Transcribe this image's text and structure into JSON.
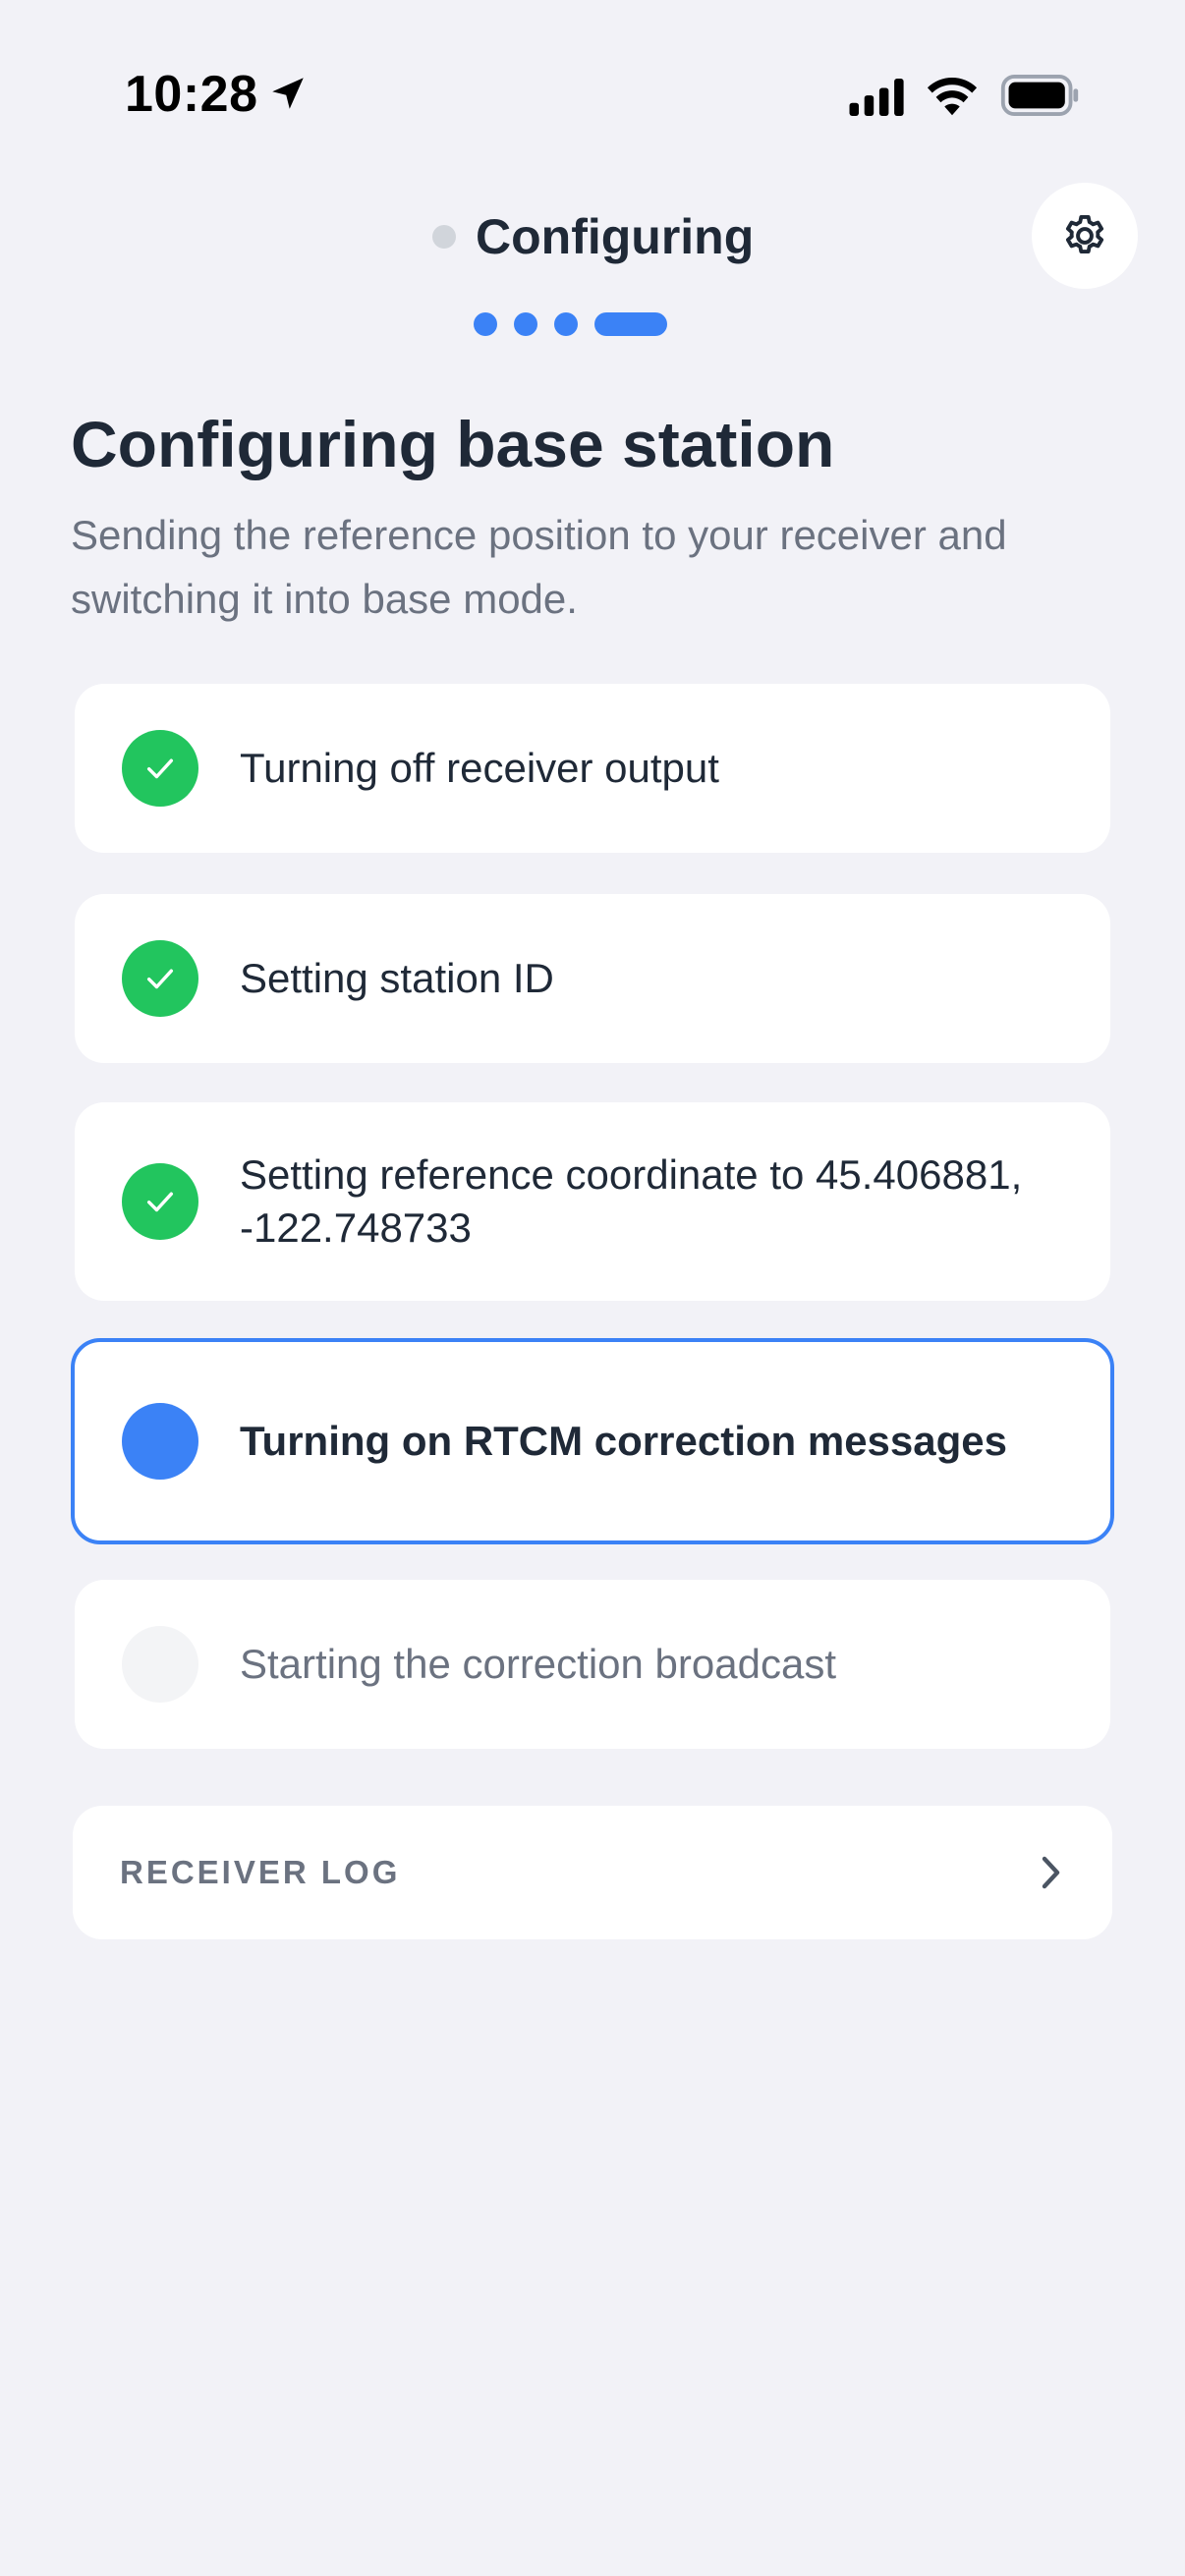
{
  "status_bar": {
    "time": "10:28"
  },
  "header": {
    "title": "Configuring"
  },
  "progress": {
    "total_steps": 4,
    "current_step": 4
  },
  "page": {
    "title": "Configuring base station",
    "subtitle": "Sending the reference position to your receiver and switching it into base mode."
  },
  "steps": [
    {
      "label": "Turning off receiver output",
      "state": "done"
    },
    {
      "label": "Setting station ID",
      "state": "done"
    },
    {
      "label": "Setting reference coordinate to 45.406881, -122.748733",
      "state": "done"
    },
    {
      "label": "Turning on RTCM correction messages",
      "state": "active"
    },
    {
      "label": "Starting the correction broadcast",
      "state": "pending"
    }
  ],
  "receiver_log": {
    "label": "RECEIVER LOG"
  },
  "colors": {
    "accent": "#3b82f6",
    "success": "#22c55e",
    "background": "#f2f2f7",
    "text": "#1f2937",
    "muted": "#6b7280"
  }
}
